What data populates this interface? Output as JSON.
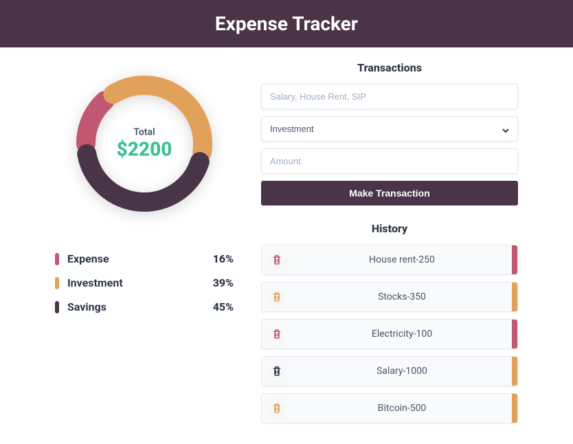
{
  "header": {
    "title": "Expense Tracker"
  },
  "colors": {
    "expense": "#c15770",
    "investment": "#e2a15a",
    "savings": "#4a3548",
    "total": "#38c28e"
  },
  "chart_data": {
    "type": "pie",
    "title": "Total",
    "total_display": "$2200",
    "series": [
      {
        "name": "Expense",
        "value": 16,
        "color": "#c15770"
      },
      {
        "name": "Investment",
        "value": 39,
        "color": "#e2a15a"
      },
      {
        "name": "Savings",
        "value": 45,
        "color": "#4a3548"
      }
    ]
  },
  "legend": [
    {
      "label": "Expense",
      "pct": "16%",
      "color": "#c15770"
    },
    {
      "label": "Investment",
      "pct": "39%",
      "color": "#e2a15a"
    },
    {
      "label": "Savings",
      "pct": "45%",
      "color": "#4a3548"
    }
  ],
  "form": {
    "section_title": "Transactions",
    "name_placeholder": "Salary, House Rent, SIP",
    "type_selected": "Investment",
    "amount_placeholder": "Amount",
    "submit_label": "Make Transaction"
  },
  "history": {
    "title": "History",
    "items": [
      {
        "text": "House rent-250",
        "category": "expense",
        "trash_color": "#c15770",
        "bar_color": "#c15770"
      },
      {
        "text": "Stocks-350",
        "category": "investment",
        "trash_color": "#e2a15a",
        "bar_color": "#e2a15a"
      },
      {
        "text": "Electricity-100",
        "category": "expense",
        "trash_color": "#c15770",
        "bar_color": "#c15770"
      },
      {
        "text": "Salary-1000",
        "category": "savings",
        "trash_color": "#2d3748",
        "bar_color": "#e2a15a"
      },
      {
        "text": "Bitcoin-500",
        "category": "investment",
        "trash_color": "#e2a15a",
        "bar_color": "#e2a15a"
      }
    ]
  }
}
